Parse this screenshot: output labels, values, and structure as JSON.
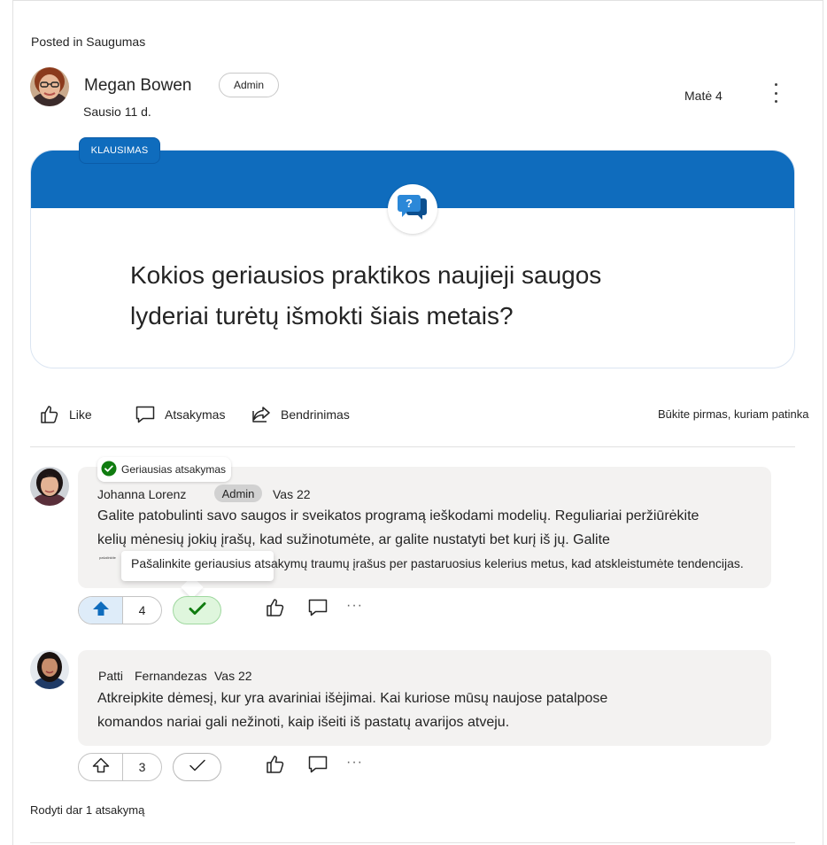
{
  "post": {
    "posted_in": "Posted in Saugumas",
    "author": "Megan Bowen",
    "role": "Admin",
    "date": "Sausio 11 d.",
    "seen": "Matė 4",
    "tag": "KLAUSIMAS",
    "question": "Kokios geriausios praktikos naujieji saugos lyderiai turėtų išmokti šiais metais?"
  },
  "actions": {
    "like": "Like",
    "reply": "Atsakymas",
    "share": "Bendrinimas",
    "be_first": "Būkite pirmas, kuriam patinka"
  },
  "replies": [
    {
      "best_answer_label": "Geriausias atsakymas",
      "author": "Johanna Lorenz",
      "role": "Admin",
      "date": "Vas 22",
      "line1": "Galite patobulinti savo saugos ir sveikatos programą ieškodami modelių. Reguliariai peržiūrėkite",
      "line2": "kelių mėnesių jokių įrašų, kad sužinotumėte, ar galite nustatyti bet kurį iš jų. Galite",
      "tooltip_small": "pašalinkite",
      "tooltip_text": "Pašalinkite geriausius atsakymų traumų įrašus per pastaruosius kelerius metus, kad atskleistumėte tendencijas.",
      "votes": "4"
    },
    {
      "author_first": "Patti",
      "author_last": "Fernandezas",
      "date": "Vas 22",
      "line1": "Atkreipkite dėmesį, kur yra avariniai išėjimai. Kai kuriose mūsų naujose patalpose",
      "line2": "komandos nariai gali nežinoti, kaip išeiti iš pastatų avarijos atveju.",
      "votes": "3"
    }
  ],
  "more_label": "···",
  "show_more": "Rodyti dar 1 atsakymą",
  "colors": {
    "brand": "#0f6cbd",
    "accept": "#107c10",
    "bubble": "#f3f2f1"
  },
  "icons": [
    "like-icon",
    "comment-icon",
    "share-icon",
    "question-icon",
    "checkmark-icon",
    "upvote-icon",
    "more-vertical-icon"
  ]
}
